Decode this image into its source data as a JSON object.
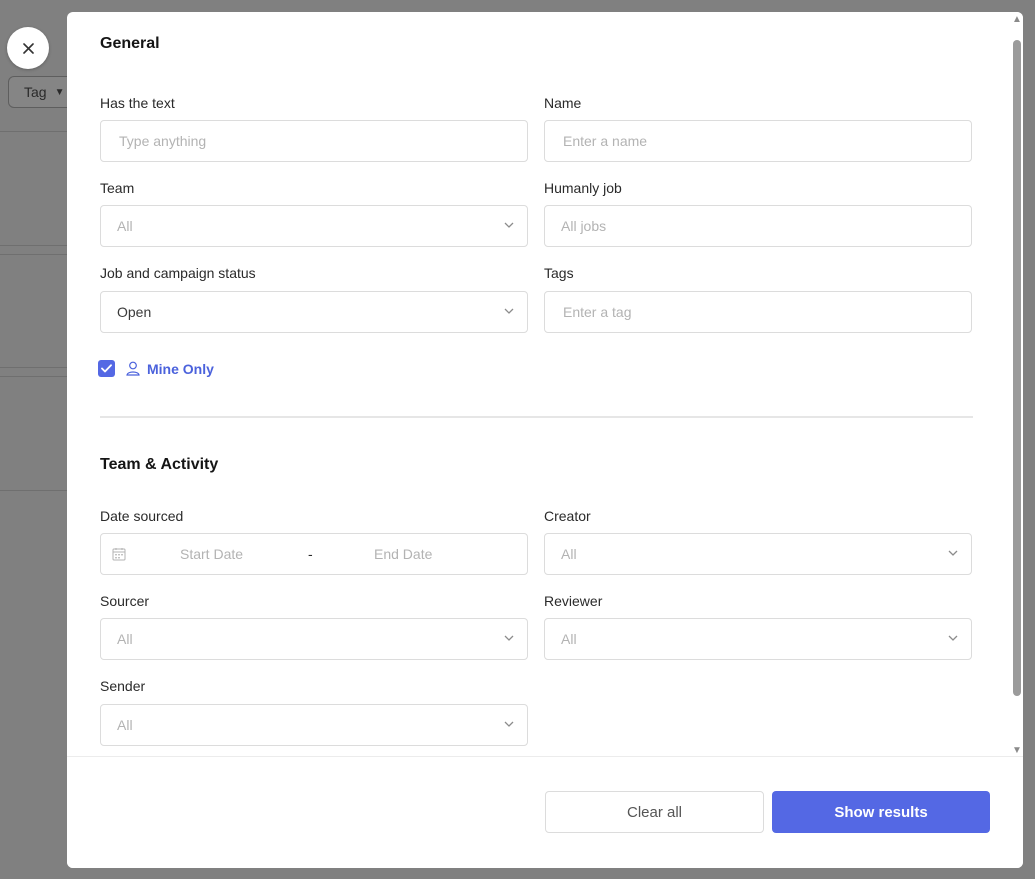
{
  "background": {
    "tag_button_label": "Tag"
  },
  "general": {
    "title": "General",
    "has_text": {
      "label": "Has the text",
      "placeholder": "Type anything"
    },
    "name": {
      "label": "Name",
      "placeholder": "Enter a name"
    },
    "team": {
      "label": "Team",
      "value": "All"
    },
    "humanly_job": {
      "label": "Humanly job",
      "value": "All jobs"
    },
    "job_status": {
      "label": "Job and campaign status",
      "value": "Open"
    },
    "tags": {
      "label": "Tags",
      "placeholder": "Enter a tag"
    },
    "mine_only": {
      "label": "Mine Only",
      "checked": true
    }
  },
  "team_activity": {
    "title": "Team & Activity",
    "date_sourced": {
      "label": "Date sourced",
      "start_placeholder": "Start Date",
      "separator": "-",
      "end_placeholder": "End Date"
    },
    "creator": {
      "label": "Creator",
      "value": "All"
    },
    "sourcer": {
      "label": "Sourcer",
      "value": "All"
    },
    "reviewer": {
      "label": "Reviewer",
      "value": "All"
    },
    "sender": {
      "label": "Sender",
      "value": "All"
    }
  },
  "footer": {
    "clear_label": "Clear all",
    "show_label": "Show results"
  },
  "colors": {
    "accent": "#5468e4",
    "overlay": "#808080"
  }
}
